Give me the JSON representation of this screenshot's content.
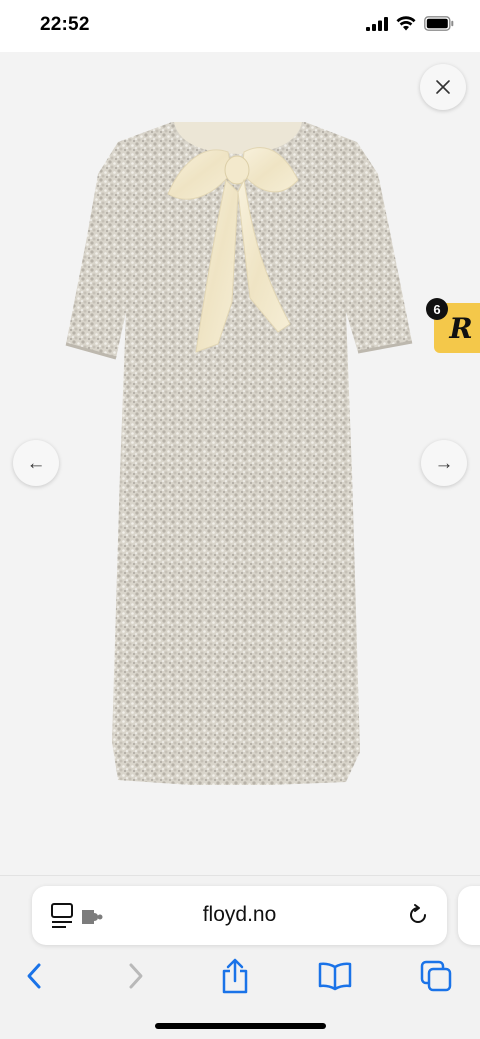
{
  "status_bar": {
    "time": "22:52"
  },
  "viewer": {
    "product_image": "sequin-dress-with-bow",
    "close_icon": "close-icon",
    "prev_arrow": "←",
    "next_arrow": "→",
    "extension_badge": {
      "letter": "R",
      "count": "6",
      "color": "#f4c84a"
    }
  },
  "browser": {
    "url": "floyd.no",
    "page_menu_icon": "page-menu-icon",
    "reload_icon": "reload-icon",
    "toolbar": [
      "back-icon",
      "forward-icon",
      "share-icon",
      "bookmarks-icon",
      "tabs-icon"
    ],
    "accent_color": "#1a73e8"
  }
}
